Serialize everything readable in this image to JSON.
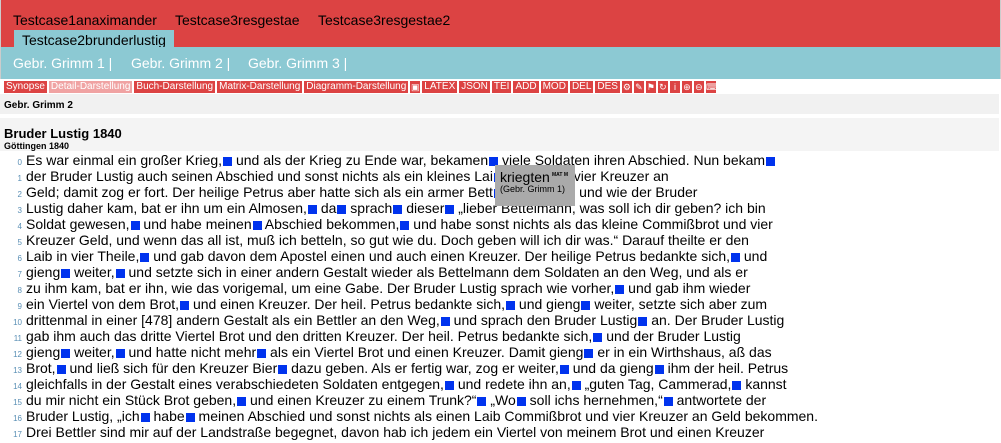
{
  "tabs": [
    "Testcase1anaximander",
    "Testcase3resgestae",
    "Testcase3resgestae2"
  ],
  "active_tab": "Testcase2brunderlustig",
  "subnav": [
    "Gebr. Grimm 1 |",
    "Gebr. Grimm 2 |",
    "Gebr. Grimm 3 |"
  ],
  "toolbar": [
    "Synopse",
    "Detail-Darstellung",
    "Buch-Darstellung",
    "Matrix-Darstellung",
    "Diagramm-Darstellung"
  ],
  "toolbar_icons": [
    "lock-icon",
    "LATEX",
    "JSON",
    "TEI",
    "ADD",
    "MOD",
    "DEL",
    "DES",
    "gear-icon",
    "pen-icon",
    "flag-icon",
    "refresh-icon",
    "info-icon",
    "zoom-in-icon",
    "zoom-out-icon",
    "keyboard-icon"
  ],
  "toolbar_text": {
    "LATEX": "LATEX",
    "JSON": "JSON",
    "TEI": "TEI",
    "ADD": "ADD",
    "MOD": "MOD",
    "DEL": "DEL",
    "DES": "DES"
  },
  "section_heading": "Gebr. Grimm 2",
  "document": {
    "title": "Bruder Lustig 1840",
    "place": "Göttingen 1840"
  },
  "tooltip": {
    "word": "kriegten",
    "tag": "MAT M",
    "source": "(Gebr. Grimm 1)"
  },
  "lines": [
    {
      "n": "0",
      "segments": [
        "Es war einmal ein großer Krieg,",
        "und als der Krieg zu Ende war, bekamen",
        "viele Soldaten ihren Abschied. Nun bekam",
        ""
      ]
    },
    {
      "n": "1",
      "segments": [
        "der Bruder Lustig auch seinen Abschied und sonst nichts als ein kleines Lai",
        "ißbrot und vier Kreuzer an"
      ]
    },
    {
      "n": "2",
      "segments": [
        "Geld; damit zog er fort. Der heilige Petrus aber hatte sich als ein armer Bett",
        "eg gesetzt, und wie der Bruder"
      ]
    },
    {
      "n": "3",
      "segments": [
        "Lustig daher kam, bat er ihn um ein Almosen,",
        "da",
        "sprach",
        "dieser",
        "„lieber Bettelmann, was soll ich dir geben? ich bin"
      ]
    },
    {
      "n": "4",
      "segments": [
        "Soldat gewesen,",
        "und habe meinen",
        "Abschied bekommen,",
        "und habe sonst nichts als das kleine Commißbrot und vier"
      ]
    },
    {
      "n": "5",
      "segments": [
        "Kreuzer Geld, und wenn das all ist, muß ich betteln, so gut wie du. Doch geben will ich dir was.“ Darauf theilte er den"
      ]
    },
    {
      "n": "6",
      "segments": [
        "Laib in vier Theile,",
        "und gab davon dem Apostel einen und auch einen Kreuzer. Der heilige Petrus bedankte sich,",
        "und"
      ]
    },
    {
      "n": "7",
      "segments": [
        "gieng",
        "weiter,",
        "und setzte sich in einer andern Gestalt wieder als Bettelmann dem Soldaten an den Weg, und als er"
      ]
    },
    {
      "n": "8",
      "segments": [
        "zu ihm kam, bat er ihn, wie das vorigemal, um eine Gabe. Der Bruder Lustig sprach wie vorher,",
        "und gab ihm wieder"
      ]
    },
    {
      "n": "9",
      "segments": [
        "ein Viertel von dem Brot,",
        "und einen Kreuzer. Der heil. Petrus bedankte sich,",
        "und gieng",
        "weiter, setzte sich aber zum"
      ]
    },
    {
      "n": "10",
      "segments": [
        "drittenmal in einer [478] andern Gestalt als ein Bettler an den Weg,",
        "und sprach den Bruder Lustig",
        "an. Der Bruder Lustig"
      ]
    },
    {
      "n": "11",
      "segments": [
        "gab ihm auch das dritte Viertel Brot und den dritten Kreuzer. Der heil. Petrus bedankte sich,",
        "und der Bruder Lustig"
      ]
    },
    {
      "n": "12",
      "segments": [
        "gieng",
        "weiter,",
        "und hatte nicht mehr",
        "als ein Viertel Brot und einen Kreuzer. Damit gieng",
        "er in ein Wirthshaus, aß das"
      ]
    },
    {
      "n": "13",
      "segments": [
        "Brot,",
        "und ließ sich für den Kreuzer Bier",
        "dazu geben. Als er fertig war, zog er weiter,",
        "und da gieng",
        "ihm der heil. Petrus"
      ]
    },
    {
      "n": "14",
      "segments": [
        "gleichfalls in der Gestalt eines verabschiedeten Soldaten entgegen,",
        "und redete ihn an,",
        "„guten Tag, Cammerad,",
        "kannst"
      ]
    },
    {
      "n": "15",
      "segments": [
        "du mir nicht ein Stück Brot geben,",
        "und einen Kreuzer zu einem Trunk?“",
        "„Wo",
        "soll ichs hernehmen,“",
        "antwortete der"
      ]
    },
    {
      "n": "16",
      "segments": [
        "Bruder Lustig, „ich",
        "habe",
        "meinen Abschied und sonst nichts als einen Laib Commißbrot und vier Kreuzer an Geld bekommen."
      ]
    },
    {
      "n": "17",
      "segments": [
        "Drei Bettler sind mir auf der Landstraße begegnet, davon hab ich jedem ein Viertel von meinem Brot und einen Kreuzer"
      ]
    }
  ]
}
